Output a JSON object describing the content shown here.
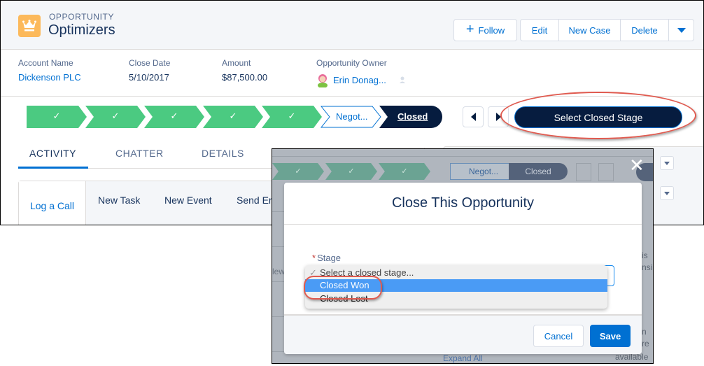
{
  "header": {
    "object_type": "OPPORTUNITY",
    "record_name": "Optimizers",
    "icon": "crown-icon",
    "icon_color": "#fcb95b",
    "actions": {
      "follow": "Follow",
      "edit": "Edit",
      "new_case": "New Case",
      "delete": "Delete"
    }
  },
  "highlights": [
    {
      "label": "Account Name",
      "value": "Dickenson PLC",
      "link": true
    },
    {
      "label": "Close Date",
      "value": "5/10/2017",
      "link": false
    },
    {
      "label": "Amount",
      "value": "$87,500.00",
      "link": false
    },
    {
      "label": "Opportunity Owner",
      "value": "Erin Donag...",
      "link": true
    }
  ],
  "path": {
    "completed_steps": 5,
    "completed_color": "#4bca81",
    "current_step": "Negot...",
    "closed_step": "Closed",
    "select_button": "Select Closed Stage",
    "closed_color": "#061c3f"
  },
  "tabs": [
    {
      "label": "ACTIVITY",
      "active": true
    },
    {
      "label": "CHATTER",
      "active": false
    },
    {
      "label": "DETAILS",
      "active": false
    }
  ],
  "activity_tabs": [
    {
      "label": "Log a Call",
      "active": true
    },
    {
      "label": "New Task",
      "active": false
    },
    {
      "label": "New Event",
      "active": false
    },
    {
      "label": "Send Em",
      "active": false
    }
  ],
  "modal": {
    "title": "Close This Opportunity",
    "backdrop": {
      "negot": "Negot...",
      "closed": "Closed",
      "left_text": "lew",
      "right_text_1": "is",
      "right_text_2": "nsi",
      "right_text_3": "n",
      "right_text_4": "re",
      "right_text_5": "available fo",
      "expand_all": "Expand All"
    },
    "field": {
      "label": "Stage",
      "required": "*",
      "options": [
        {
          "label": "Select a closed stage...",
          "checked": true,
          "highlighted": false
        },
        {
          "label": "Closed Won",
          "checked": false,
          "highlighted": true
        },
        {
          "label": "Closed Lost",
          "checked": false,
          "highlighted": false
        }
      ]
    },
    "cancel_label": "Cancel",
    "save_label": "Save",
    "close_glyph": "✕",
    "accent": "#0070d2"
  },
  "annotation_color": "#e05a4f"
}
